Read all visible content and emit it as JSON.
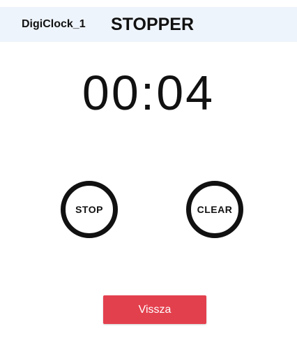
{
  "header": {
    "device_name": "DigiClock_1",
    "title": "STOPPER"
  },
  "timer": {
    "display": "00:04"
  },
  "controls": {
    "stop_label": "STOP",
    "clear_label": "CLEAR",
    "back_label": "Vissza"
  },
  "colors": {
    "header_bg": "#eef4fb",
    "back_button": "#e3404d",
    "round_button_border": "#111111"
  }
}
